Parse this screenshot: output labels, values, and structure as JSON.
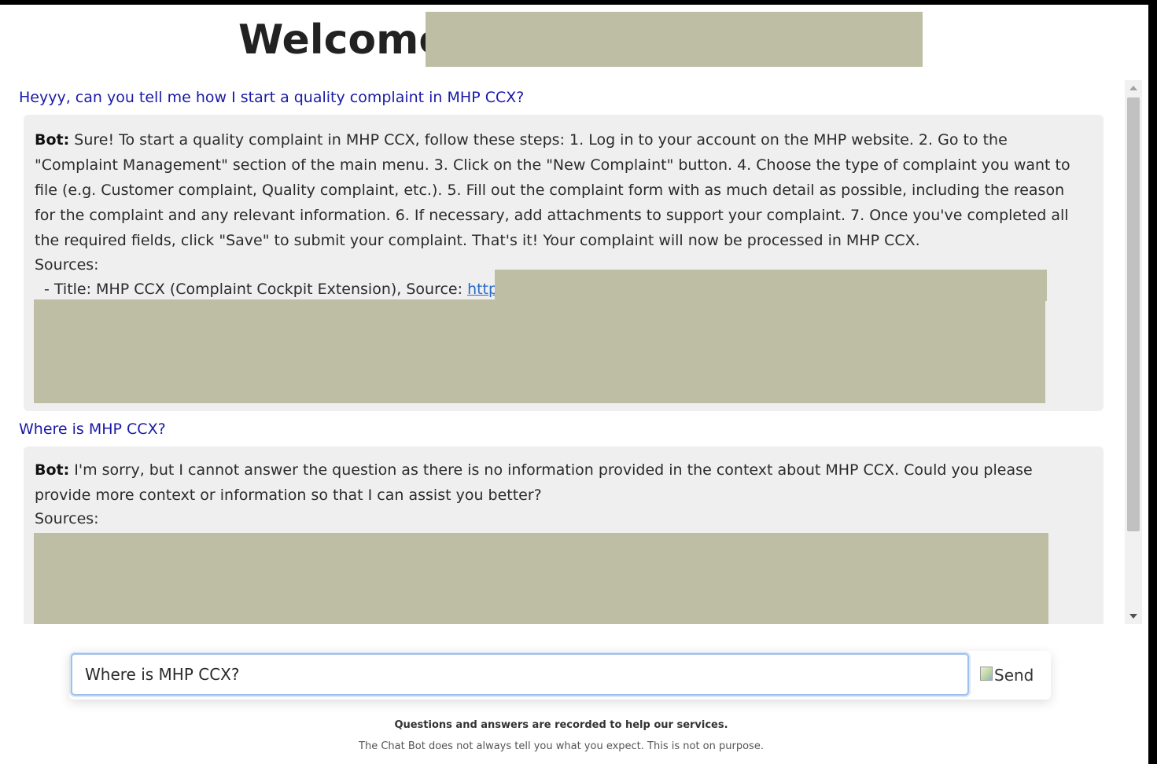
{
  "header": {
    "welcome_label": "Welcome"
  },
  "conversation": [
    {
      "user": "Heyyy, can you tell me how I start a quality complaint in MHP CCX?",
      "bot_prefix": "Bot:",
      "bot_text": "Sure! To start a quality complaint in MHP CCX, follow these steps: 1. Log in to your account on the MHP website. 2. Go to the \"Complaint Management\" section of the main menu. 3. Click on the \"New Complaint\" button. 4. Choose the type of complaint you want to file (e.g. Customer complaint, Quality complaint, etc.). 5. Fill out the complaint form with as much detail as possible, including the reason for the complaint and any relevant information. 6. If necessary, add attachments to support your complaint. 7. Once you've completed all the required fields, click \"Save\" to submit your complaint. That's it! Your complaint will now be processed in MHP CCX.",
      "sources_label": "Sources:",
      "source_prefix": "- Title: MHP CCX (Complaint Cockpit Extension), Source: ",
      "source_link": "https:"
    },
    {
      "user": "Where is MHP CCX?",
      "bot_prefix": "Bot:",
      "bot_text": "I'm sorry, but I cannot answer the question as there is no information provided in the context about MHP CCX. Could you please provide more context or information so that I can assist you better?",
      "sources_label": "Sources:"
    }
  ],
  "input": {
    "value": "Where is MHP CCX?"
  },
  "send_button": {
    "label": "Send"
  },
  "footer": {
    "line1": "Questions and answers are recorded to help our services.",
    "line2": "The Chat Bot does not always tell you what you expect. This is not on purpose."
  },
  "colors": {
    "redaction": "#bebea5",
    "user_text": "#1a1aa8",
    "bot_bubble": "#efefef",
    "link": "#2a6ac7"
  }
}
